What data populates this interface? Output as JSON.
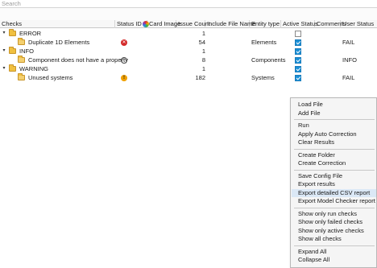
{
  "search": {
    "placeholder": "Search"
  },
  "columns": {
    "checks": "Checks",
    "status_id": "Status ID",
    "card_image": "Card Image",
    "issue_count": "Issue Count",
    "include_file_name": "Include File Name",
    "entity_type": "Entity type",
    "active_status": "Active Status",
    "comments": "Comments",
    "user_status": "User Status"
  },
  "rows": [
    {
      "name": "ERROR",
      "issue_count": "1",
      "active": false,
      "entity": "",
      "user_status": ""
    },
    {
      "name": "Duplicate 1D Elements",
      "status_icon": "error-icon",
      "issue_count": "54",
      "entity": "Elements",
      "active": true,
      "user_status": "FAIL"
    },
    {
      "name": "INFO",
      "issue_count": "1",
      "active": true,
      "entity": "",
      "user_status": ""
    },
    {
      "name": "Component does not have a property",
      "status_icon": "info-icon",
      "issue_count": "8",
      "entity": "Components",
      "active": true,
      "user_status": "INFO"
    },
    {
      "name": "WARNING",
      "issue_count": "1",
      "active": true,
      "entity": "",
      "user_status": ""
    },
    {
      "name": "Unused systems",
      "status_icon": "warning-icon",
      "issue_count": "182",
      "entity": "Systems",
      "active": true,
      "user_status": "FAIL"
    }
  ],
  "icons": {
    "error_glyph": "✕",
    "info_glyph": "i",
    "warning_glyph": "!",
    "expand_glyph": "▾"
  },
  "context_menu": {
    "items": [
      "Load File",
      "Add File",
      "Run",
      "Apply Auto Correction",
      "Clear Results",
      "Create Folder",
      "Create Correction",
      "Save Config File",
      "Export results",
      "Export detailed CSV report",
      "Export Model Checker report",
      "Show only run checks",
      "Show only failed checks",
      "Show only active checks",
      "Show all checks",
      "Expand All",
      "Collapse All"
    ],
    "highlighted_index": 9
  },
  "colors": {
    "accent_checkbox": "#1a8fd6",
    "error": "#d42a2a",
    "warning": "#f0a000",
    "folder": "#f0c040",
    "menu_highlight": "#dbe8f6"
  }
}
